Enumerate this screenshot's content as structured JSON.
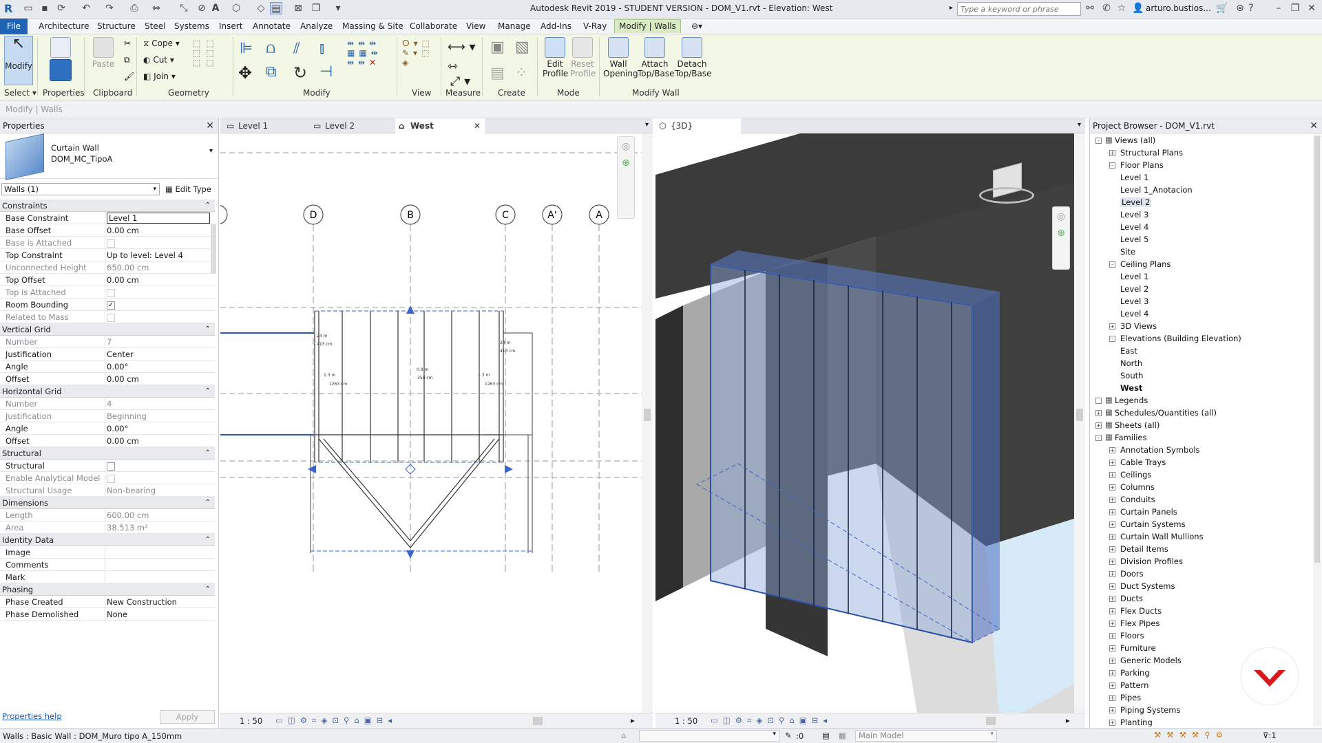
{
  "title_bar": {
    "title": "Autodesk Revit 2019 - STUDENT VERSION - DOM_V1.rvt - Elevation: West",
    "search_placeholder": "Type a keyword or phrase",
    "user": "arturo.bustios..."
  },
  "menu": {
    "file": "File",
    "tabs": [
      "Architecture",
      "Structure",
      "Steel",
      "Systems",
      "Insert",
      "Annotate",
      "Analyze",
      "Massing & Site",
      "Collaborate",
      "View",
      "Manage",
      "Add-Ins",
      "V-Ray",
      "Modify | Walls"
    ]
  },
  "ribbon": {
    "modify": "Modify",
    "properties": "Properties",
    "paste": "Paste",
    "cope": "Cope",
    "cut": "Cut",
    "join": "Join",
    "edit_profile": [
      "Edit",
      "Profile"
    ],
    "reset_profile": [
      "Reset",
      "Profile"
    ],
    "wall_opening": [
      "Wall",
      "Opening"
    ],
    "attach": [
      "Attach",
      "Top/Base"
    ],
    "detach": [
      "Detach",
      "Top/Base"
    ],
    "groups": {
      "select": "Select",
      "properties": "Properties",
      "clipboard": "Clipboard",
      "geometry": "Geometry",
      "modify": "Modify",
      "view": "View",
      "measure": "Measure",
      "create": "Create",
      "mode": "Mode",
      "modify_wall": "Modify Wall"
    }
  },
  "options_bar": "Modify | Walls",
  "properties": {
    "title": "Properties",
    "type_family": "Curtain Wall",
    "type_name": "DOM_MC_TipoA",
    "selector": "Walls (1)",
    "edit_type": "Edit Type",
    "sections": [
      {
        "name": "Constraints",
        "rows": [
          {
            "k": "Base Constraint",
            "v": "Level 1"
          },
          {
            "k": "Base Offset",
            "v": "0.00 cm"
          },
          {
            "k": "Base is Attached",
            "v": "",
            "cb": true,
            "grey": true
          },
          {
            "k": "Top Constraint",
            "v": "Up to level: Level 4"
          },
          {
            "k": "Unconnected Height",
            "v": "650.00 cm",
            "grey": true
          },
          {
            "k": "Top Offset",
            "v": "0.00 cm"
          },
          {
            "k": "Top is Attached",
            "v": "",
            "cb": true,
            "grey": true
          },
          {
            "k": "Room Bounding",
            "v": "",
            "cb": true,
            "checked": true
          },
          {
            "k": "Related to Mass",
            "v": "",
            "cb": true,
            "grey": true
          }
        ]
      },
      {
        "name": "Vertical Grid",
        "rows": [
          {
            "k": "Number",
            "v": "7",
            "grey": true
          },
          {
            "k": "Justification",
            "v": "Center"
          },
          {
            "k": "Angle",
            "v": "0.00°"
          },
          {
            "k": "Offset",
            "v": "0.00 cm"
          }
        ]
      },
      {
        "name": "Horizontal Grid",
        "rows": [
          {
            "k": "Number",
            "v": "4",
            "grey": true
          },
          {
            "k": "Justification",
            "v": "Beginning",
            "grey": true
          },
          {
            "k": "Angle",
            "v": "0.00°"
          },
          {
            "k": "Offset",
            "v": "0.00 cm"
          }
        ]
      },
      {
        "name": "Structural",
        "rows": [
          {
            "k": "Structural",
            "v": "",
            "cb": true
          },
          {
            "k": "Enable Analytical Model",
            "v": "",
            "cb": true,
            "grey": true
          },
          {
            "k": "Structural Usage",
            "v": "Non-bearing",
            "grey": true
          }
        ]
      },
      {
        "name": "Dimensions",
        "rows": [
          {
            "k": "Length",
            "v": "600.00 cm",
            "grey": true
          },
          {
            "k": "Area",
            "v": "38.513 m²",
            "grey": true
          }
        ]
      },
      {
        "name": "Identity Data",
        "rows": [
          {
            "k": "Image",
            "v": ""
          },
          {
            "k": "Comments",
            "v": ""
          },
          {
            "k": "Mark",
            "v": ""
          }
        ]
      },
      {
        "name": "Phasing",
        "rows": [
          {
            "k": "Phase Created",
            "v": "New Construction"
          },
          {
            "k": "Phase Demolished",
            "v": "None"
          }
        ]
      }
    ],
    "help": "Properties help",
    "apply": "Apply"
  },
  "view_tabs": [
    "Level 1",
    "Level 2",
    "West"
  ],
  "view3d_tab": "{3D}",
  "elevation": {
    "grid_labels": [
      "D",
      "B",
      "C",
      "A'",
      "A"
    ],
    "scale": "1 : 50",
    "dims": [
      "1.3 m",
      "1263 cm",
      "0.9 m",
      "350 cm",
      "1.3 m",
      "1263 cm",
      "24 m",
      "413 cm",
      "24 m",
      "413 cm"
    ]
  },
  "view3d": {
    "scale": "1 : 50"
  },
  "browser": {
    "title": "Project Browser - DOM_V1.rvt",
    "tree": [
      {
        "t": "Views (all)",
        "d": 0,
        "box": "-"
      },
      {
        "t": "Structural Plans",
        "d": 1,
        "box": "+"
      },
      {
        "t": "Floor Plans",
        "d": 1,
        "box": "-"
      },
      {
        "t": "Level 1",
        "d": 2
      },
      {
        "t": "Level 1_Anotacion",
        "d": 2
      },
      {
        "t": "Level 2",
        "d": 2,
        "sel": true
      },
      {
        "t": "Level 3",
        "d": 2
      },
      {
        "t": "Level 4",
        "d": 2
      },
      {
        "t": "Level 5",
        "d": 2
      },
      {
        "t": "Site",
        "d": 2
      },
      {
        "t": "Ceiling Plans",
        "d": 1,
        "box": "-"
      },
      {
        "t": "Level 1",
        "d": 2
      },
      {
        "t": "Level 2",
        "d": 2
      },
      {
        "t": "Level 3",
        "d": 2
      },
      {
        "t": "Level 4",
        "d": 2
      },
      {
        "t": "3D Views",
        "d": 1,
        "box": "+"
      },
      {
        "t": "Elevations (Building Elevation)",
        "d": 1,
        "box": "-"
      },
      {
        "t": "East",
        "d": 2
      },
      {
        "t": "North",
        "d": 2
      },
      {
        "t": "South",
        "d": 2
      },
      {
        "t": "West",
        "d": 2,
        "bold": true
      },
      {
        "t": "Legends",
        "d": 0,
        "box": ""
      },
      {
        "t": "Schedules/Quantities (all)",
        "d": 0,
        "box": "+"
      },
      {
        "t": "Sheets (all)",
        "d": 0,
        "box": "+"
      },
      {
        "t": "Families",
        "d": 0,
        "box": "-"
      },
      {
        "t": "Annotation Symbols",
        "d": 1,
        "box": "+"
      },
      {
        "t": "Cable Trays",
        "d": 1,
        "box": "+"
      },
      {
        "t": "Ceilings",
        "d": 1,
        "box": "+"
      },
      {
        "t": "Columns",
        "d": 1,
        "box": "+"
      },
      {
        "t": "Conduits",
        "d": 1,
        "box": "+"
      },
      {
        "t": "Curtain Panels",
        "d": 1,
        "box": "+"
      },
      {
        "t": "Curtain Systems",
        "d": 1,
        "box": "+"
      },
      {
        "t": "Curtain Wall Mullions",
        "d": 1,
        "box": "+"
      },
      {
        "t": "Detail Items",
        "d": 1,
        "box": "+"
      },
      {
        "t": "Division Profiles",
        "d": 1,
        "box": "+"
      },
      {
        "t": "Doors",
        "d": 1,
        "box": "+"
      },
      {
        "t": "Duct Systems",
        "d": 1,
        "box": "+"
      },
      {
        "t": "Ducts",
        "d": 1,
        "box": "+"
      },
      {
        "t": "Flex Ducts",
        "d": 1,
        "box": "+"
      },
      {
        "t": "Flex Pipes",
        "d": 1,
        "box": "+"
      },
      {
        "t": "Floors",
        "d": 1,
        "box": "+"
      },
      {
        "t": "Furniture",
        "d": 1,
        "box": "+"
      },
      {
        "t": "Generic Models",
        "d": 1,
        "box": "+"
      },
      {
        "t": "Parking",
        "d": 1,
        "box": "+"
      },
      {
        "t": "Pattern",
        "d": 1,
        "box": "+"
      },
      {
        "t": "Pipes",
        "d": 1,
        "box": "+"
      },
      {
        "t": "Piping Systems",
        "d": 1,
        "box": "+"
      },
      {
        "t": "Planting",
        "d": 1,
        "box": "+"
      }
    ]
  },
  "status": {
    "text": "Walls : Basic Wall : DOM_Muro tipo A_150mm",
    "zero": ":0",
    "model": "Main Model"
  },
  "colors": {
    "accent": "#1e63b4",
    "ribbon_bg": "#f2f7e6",
    "selection": "#3b64c8",
    "logo": "#d7191c"
  }
}
